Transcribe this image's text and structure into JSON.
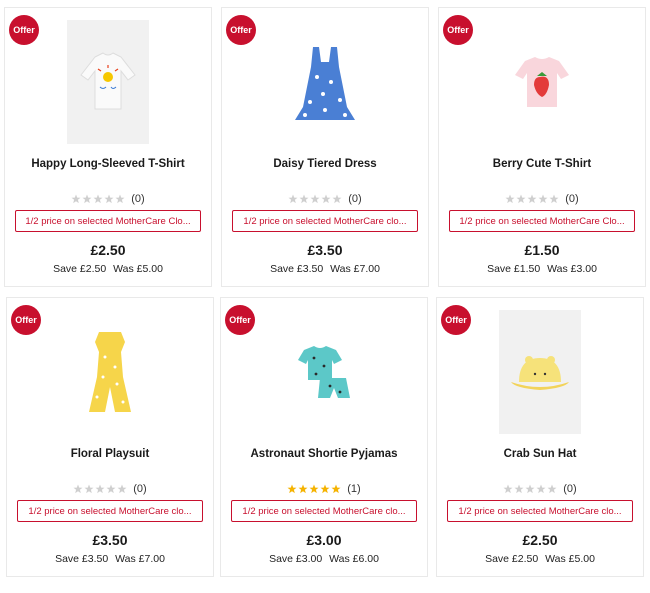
{
  "products": [
    {
      "offer_badge": "Offer",
      "name": "Happy Long-Sleeved T-Shirt",
      "rating_count": "(0)",
      "stars": 0,
      "promo": "1/2 price on selected MotherCare Clo...",
      "price": "£2.50",
      "save": "Save £2.50",
      "was": "Was £5.00",
      "image_icon": "longsleeve-tshirt-image"
    },
    {
      "offer_badge": "Offer",
      "name": "Daisy Tiered Dress",
      "rating_count": "(0)",
      "stars": 0,
      "promo": "1/2 price on selected MotherCare clo...",
      "price": "£3.50",
      "save": "Save £3.50",
      "was": "Was £7.00",
      "image_icon": "dress-image"
    },
    {
      "offer_badge": "Offer",
      "name": "Berry Cute T-Shirt",
      "rating_count": "(0)",
      "stars": 0,
      "promo": "1/2 price on selected MotherCare Clo...",
      "price": "£1.50",
      "save": "Save £1.50",
      "was": "Was £3.00",
      "image_icon": "tshirt-image"
    },
    {
      "offer_badge": "Offer",
      "name": "Floral Playsuit",
      "rating_count": "(0)",
      "stars": 0,
      "promo": "1/2 price on selected MotherCare clo...",
      "price": "£3.50",
      "save": "Save £3.50",
      "was": "Was £7.00",
      "image_icon": "playsuit-image"
    },
    {
      "offer_badge": "Offer",
      "name": "Astronaut Shortie Pyjamas",
      "rating_count": "(1)",
      "stars": 5,
      "promo": "1/2 price on selected MotherCare clo...",
      "price": "£3.00",
      "save": "Save £3.00",
      "was": "Was £6.00",
      "image_icon": "pyjamas-image"
    },
    {
      "offer_badge": "Offer",
      "name": "Crab Sun Hat",
      "rating_count": "(0)",
      "stars": 0,
      "promo": "1/2 price on selected MotherCare clo...",
      "price": "£2.50",
      "save": "Save £2.50",
      "was": "Was £5.00",
      "image_icon": "sun-hat-image"
    }
  ],
  "colors": {
    "offer_red": "#c8102e",
    "star_gold": "#f5b301",
    "star_empty": "#cfcfcf"
  }
}
